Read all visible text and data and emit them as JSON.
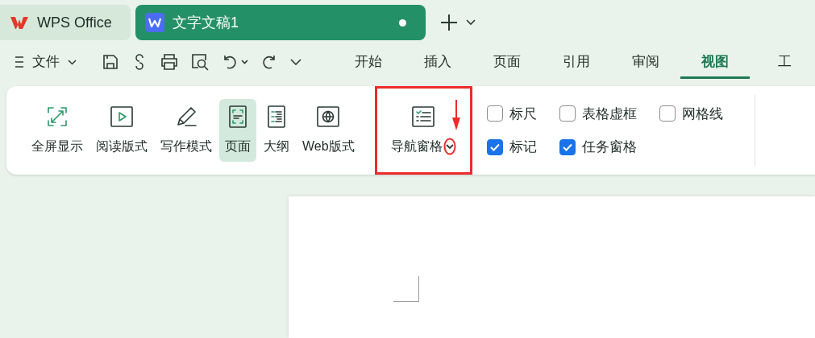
{
  "tabs": [
    {
      "kind": "home",
      "label": "WPS Office",
      "selected": false,
      "modified": false
    },
    {
      "kind": "doc",
      "label": "文字文稿1",
      "selected": true,
      "modified": true
    }
  ],
  "file_menu": {
    "label": "文件"
  },
  "menu_tabs": [
    {
      "label": "开始",
      "selected": false
    },
    {
      "label": "插入",
      "selected": false
    },
    {
      "label": "页面",
      "selected": false
    },
    {
      "label": "引用",
      "selected": false
    },
    {
      "label": "审阅",
      "selected": false
    },
    {
      "label": "视图",
      "selected": true
    },
    {
      "label": "工",
      "selected": false
    }
  ],
  "ribbon_buttons": [
    {
      "kind": "fullscreen",
      "label": "全屏显示",
      "selected": false
    },
    {
      "kind": "read",
      "label": "阅读版式",
      "selected": false
    },
    {
      "kind": "write",
      "label": "写作模式",
      "selected": false
    },
    {
      "kind": "page",
      "label": "页面",
      "selected": true
    },
    {
      "kind": "outline",
      "label": "大纲",
      "selected": false
    },
    {
      "kind": "web",
      "label": "Web版式",
      "selected": false
    },
    {
      "kind": "nav",
      "label": "导航窗格",
      "selected": false
    }
  ],
  "checkboxes": [
    {
      "label": "标尺",
      "checked": false
    },
    {
      "label": "表格虚框",
      "checked": false
    },
    {
      "label": "网格线",
      "checked": false
    },
    {
      "label": "标记",
      "checked": true
    },
    {
      "label": "任务窗格",
      "checked": true
    }
  ]
}
